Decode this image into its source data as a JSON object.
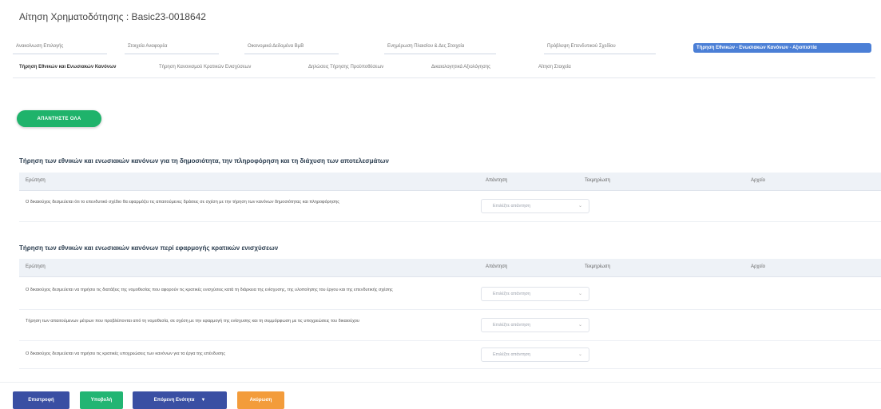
{
  "header": {
    "title": "Αίτηση Χρηματοδότησης : Basic23-0018642"
  },
  "tabs_primary": [
    {
      "label": "Ανακοίνωση Επιλογής"
    },
    {
      "label": "Στοιχεία Αναφορέα"
    },
    {
      "label": "Οικονομικά Δεδομένα ΒμΒ"
    },
    {
      "label": "Ενημέρωση Πλαισίου & Δες Στοιχεία"
    },
    {
      "label": "Πρόβλεψη Επενδυτικού Σχεδίου"
    },
    {
      "label": "Τήρηση Εθνικών - Ενωσιακών Κανόνων - Αξιοπιστία"
    }
  ],
  "tabs_secondary": [
    {
      "label": "Τήρηση Εθνικών και Ενωσιακών Κανόνων"
    },
    {
      "label": "Τήρηση Κανονισμού Κρατικών Ενισχύσεων"
    },
    {
      "label": "Δηλώσεις Τήρησης Προϋποθέσεων"
    },
    {
      "label": "Δικαιολογητικά Αξιολόγησης"
    },
    {
      "label": "Αίτηση Στοιχεία"
    }
  ],
  "actions": {
    "primary_pill": "ΑΠΑΝΤΗΣΤΕ ΟΛΑ"
  },
  "sections": [
    {
      "title": "Τήρηση των εθνικών και ενωσιακών κανόνων για τη δημοσιότητα, την πληροφόρηση και τη διάχυση των αποτελεσμάτων",
      "columns": [
        "Ερώτηση",
        "Απάντηση",
        "Τεκμηρίωση",
        "Αρχείο"
      ],
      "rows": [
        {
          "question": "Ο δικαιούχος δεσμεύεται ότι το επενδυτικό σχέδιο θα εφαρμόζει τις απαιτούμενες δράσεις σε σχέση με την τήρηση των κανόνων δημοσιότητας και πληροφόρησης",
          "answer_placeholder": "Επιλέξτε απάντηση"
        }
      ]
    },
    {
      "title": "Τήρηση των εθνικών και ενωσιακών κανόνων περί εφαρμογής κρατικών ενισχύσεων",
      "columns": [
        "Ερώτηση",
        "Απάντηση",
        "Τεκμηρίωση",
        "Αρχείο"
      ],
      "rows": [
        {
          "question": "Ο δικαιούχος δεσμεύεται να τηρήσει τις διατάξεις της νομοθεσίας που αφορούν τις κρατικές ενισχύσεις κατά τη διάρκεια της ενίσχυσης, της υλοποίησης του έργου και της επενδυτικής σχέσης",
          "answer_placeholder": "Επιλέξτε απάντηση"
        },
        {
          "question": "Τήρηση των απαιτούμενων μέτρων που προβλέπονται από τη νομοθεσία, σε σχέση με την εφαρμογή της ενίσχυσης και τη συμμόρφωση με τις υποχρεώσεις του δικαιούχου",
          "answer_placeholder": "Επιλέξτε απάντηση"
        },
        {
          "question": "Ο δικαιούχος δεσμεύεται να τηρήσει τις κρατικές υποχρεώσεις των κανόνων για τα έργα της επένδυσης",
          "answer_placeholder": "Επιλέξτε απάντηση"
        }
      ]
    }
  ],
  "footer": {
    "btn_back": "Επιστροφή",
    "btn_save": "Υποβολή",
    "btn_next": "Επόμενη Ενότητα",
    "btn_cancel": "Ακύρωση"
  },
  "colors": {
    "active_tab": "#4b7fd6",
    "pill_green": "#1fb36b",
    "footer_blue": "#3a4fa3",
    "footer_green": "#22b573",
    "footer_orange": "#f39c3b"
  }
}
